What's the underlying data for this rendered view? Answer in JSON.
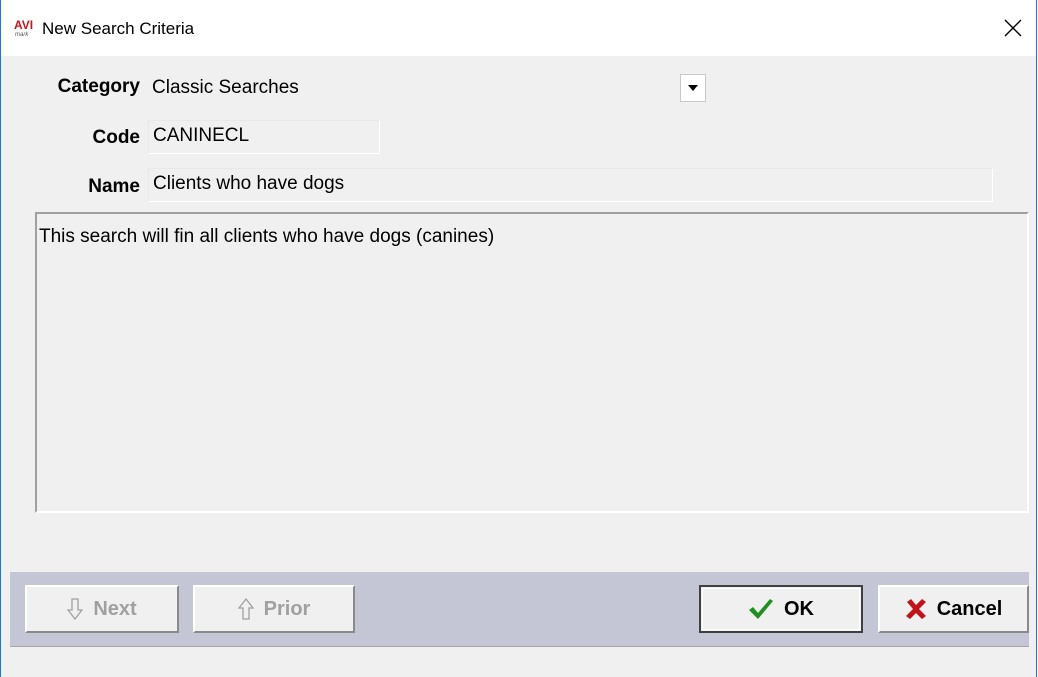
{
  "window": {
    "title": "New Search Criteria",
    "app_icon_text": "AVI",
    "app_icon_subtext": "mark"
  },
  "form": {
    "category_label": "Category",
    "category_value": "Classic Searches",
    "code_label": "Code",
    "code_value": "CANINECL",
    "name_label": "Name",
    "name_value": "Clients who have dogs",
    "description": "This search will fin all clients who have dogs (canines)"
  },
  "buttons": {
    "next_label": "Next",
    "prior_label": "Prior",
    "ok_label": "OK",
    "cancel_label": "Cancel"
  },
  "colors": {
    "button_bar": "#c4c6d6",
    "ok_check": "#1f8f1f",
    "cancel_x": "#c0141a"
  }
}
